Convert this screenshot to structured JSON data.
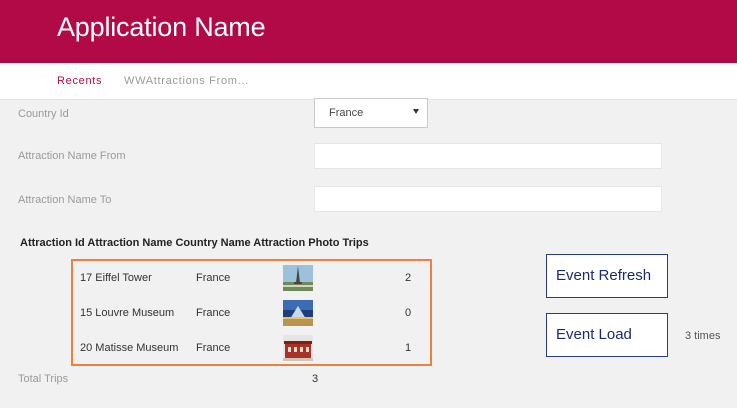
{
  "app": {
    "title": "Application Name"
  },
  "breadcrumb": {
    "recents": "Recents",
    "current": "WWAttractions From..."
  },
  "form": {
    "country_label": "Country Id",
    "country_value": "France",
    "name_from_label": "Attraction Name From",
    "name_from_value": "",
    "name_to_label": "Attraction Name To",
    "name_to_value": ""
  },
  "grid": {
    "headers": "Attraction Id Attraction Name Country Name Attraction Photo Trips",
    "rows": [
      {
        "id_name": "17 Eiffel Tower",
        "country": "France",
        "photo": "eiffel-tower-photo",
        "trips": "2"
      },
      {
        "id_name": "15 Louvre Museum",
        "country": "France",
        "photo": "louvre-museum-photo",
        "trips": "0"
      },
      {
        "id_name": "20 Matisse Museum",
        "country": "France",
        "photo": "matisse-museum-photo",
        "trips": "1"
      }
    ]
  },
  "buttons": {
    "refresh": "Event Refresh",
    "load": "Event Load"
  },
  "load_count": "3 times",
  "totals": {
    "label": "Total Trips",
    "value": "3"
  },
  "colors": {
    "brand": "#b10a46",
    "highlight": "#e9823f",
    "button_border": "#2a3b84"
  }
}
